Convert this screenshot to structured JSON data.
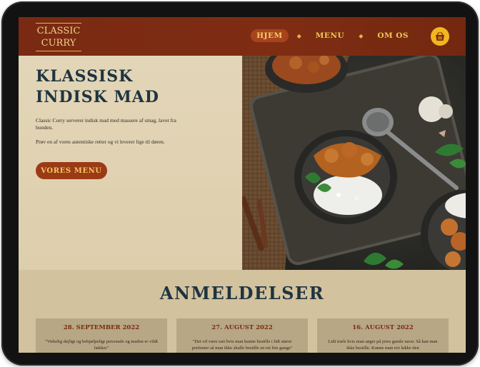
{
  "nav": {
    "logo_line1": "CLASSIC",
    "logo_line2": "CURRY",
    "links": [
      {
        "label": "HJEM",
        "active": true
      },
      {
        "label": "MENU",
        "active": false
      },
      {
        "label": "OM OS",
        "active": false
      }
    ],
    "basket_icon": "basket-icon"
  },
  "hero": {
    "title_line1": "KLASSISK",
    "title_line2": "INDISK MAD",
    "text1": "Classic Curry serverer indisk mad med massere af smag, lavet fra bunden.",
    "text2": "Prøv en af vores autentiske retter og vi leverer lige til døren.",
    "cta_label": "VORES MENU"
  },
  "reviews": {
    "title": "ANMELDELSER",
    "items": [
      {
        "date": "28. SEPTEMBER 2022",
        "text": "\"Virkelig dejligt og behjælpeligt personale og maden er vildt lækker\""
      },
      {
        "date": "27. AUGUST 2022",
        "text": "\"Det vil være rart hvis man kunne bestille i lidt større portioner så man ikke skulle bestille en ret fire gange\""
      },
      {
        "date": "16. AUGUST 2022",
        "text": "Lidt træls hvis man søger på jeres gamle navn. Så kan man ikke bestille. Kunne man evt lukke den"
      }
    ]
  },
  "colors": {
    "nav_bg": "#7a2a12",
    "gold": "#f0c955",
    "cta_bg": "#9b3a17",
    "hero_bg": "#e3d6b8",
    "title": "#1f3440",
    "reviews_bg": "#d3c29e",
    "card_bg": "#b7a784"
  }
}
